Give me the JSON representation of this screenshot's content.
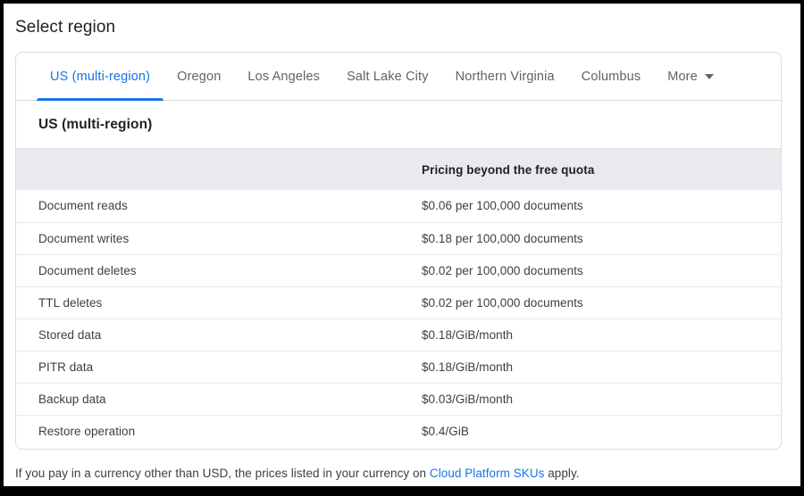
{
  "page": {
    "title": "Select region"
  },
  "tabs": {
    "items": [
      {
        "label": "US (multi-region)",
        "active": true
      },
      {
        "label": "Oregon",
        "active": false
      },
      {
        "label": "Los Angeles",
        "active": false
      },
      {
        "label": "Salt Lake City",
        "active": false
      },
      {
        "label": "Northern Virginia",
        "active": false
      },
      {
        "label": "Columbus",
        "active": false
      }
    ],
    "more_label": "More",
    "more_icon": "chevron-down-icon"
  },
  "region_panel": {
    "heading": "US (multi-region)",
    "table": {
      "columns": [
        "",
        "Pricing beyond the free quota"
      ],
      "rows": [
        {
          "label": "Document reads",
          "price": "$0.06 per 100,000 documents"
        },
        {
          "label": "Document writes",
          "price": "$0.18 per 100,000 documents"
        },
        {
          "label": "Document deletes",
          "price": "$0.02 per 100,000 documents"
        },
        {
          "label": "TTL deletes",
          "price": "$0.02 per 100,000 documents"
        },
        {
          "label": "Stored data",
          "price": "$0.18/GiB/month"
        },
        {
          "label": "PITR data",
          "price": "$0.18/GiB/month"
        },
        {
          "label": "Backup data",
          "price": "$0.03/GiB/month"
        },
        {
          "label": "Restore operation",
          "price": "$0.4/GiB"
        }
      ]
    }
  },
  "footnote": {
    "prefix": "If you pay in a currency other than USD, the prices listed in your currency on ",
    "link_text": "Cloud Platform SKUs",
    "suffix": " apply."
  },
  "colors": {
    "accent": "#1a73e8",
    "text_primary": "#202124",
    "text_secondary": "#5f6368",
    "table_header_bg": "#e8eaed",
    "border": "#dadce0"
  }
}
